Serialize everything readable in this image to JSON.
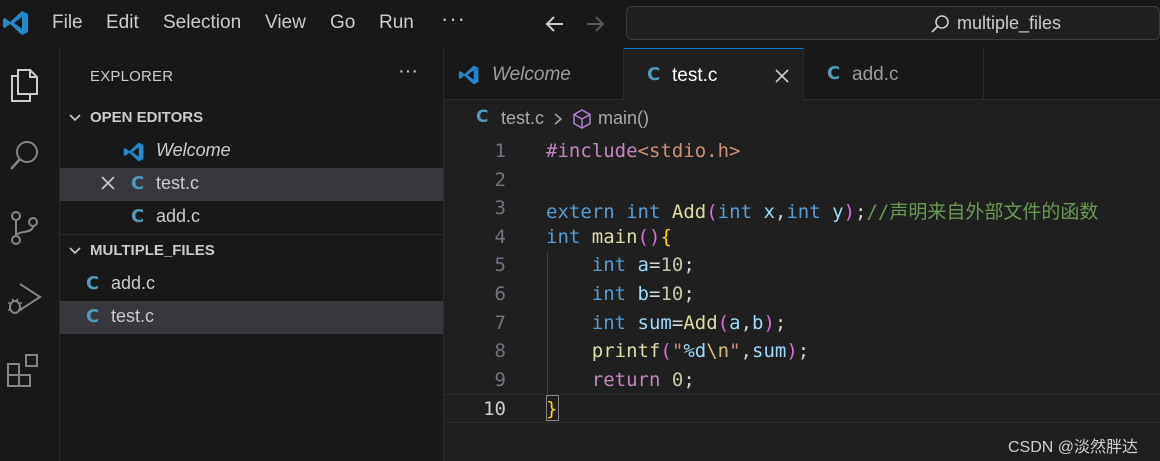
{
  "titlebar": {
    "menus": [
      "File",
      "Edit",
      "Selection",
      "View",
      "Go",
      "Run"
    ],
    "more": "···",
    "command_center": "multiple_files"
  },
  "activity_bar": {
    "icons": [
      "explorer-icon",
      "search-icon",
      "source-control-icon",
      "run-debug-icon",
      "extensions-icon"
    ]
  },
  "sidebar": {
    "title": "EXPLORER",
    "more": "···",
    "open_editors": {
      "label": "OPEN EDITORS",
      "items": [
        {
          "name": "Welcome",
          "icon": "vscode-logo-icon"
        },
        {
          "name": "test.c",
          "icon_letter": "C",
          "selected": true
        },
        {
          "name": "add.c",
          "icon_letter": "C"
        }
      ]
    },
    "folder": {
      "label": "MULTIPLE_FILES",
      "items": [
        {
          "name": "add.c",
          "icon_letter": "C"
        },
        {
          "name": "test.c",
          "icon_letter": "C",
          "selected": true
        }
      ]
    }
  },
  "tabs": [
    {
      "label": "Welcome",
      "icon": "vscode-logo-icon"
    },
    {
      "label": "test.c",
      "icon_letter": "C",
      "active": true
    },
    {
      "label": "add.c",
      "icon_letter": "C"
    }
  ],
  "breadcrumb": {
    "file": "test.c",
    "file_icon_letter": "C",
    "symbol": "main()"
  },
  "editor": {
    "line_numbers": [
      "1",
      "2",
      "3",
      "4",
      "5",
      "6",
      "7",
      "8",
      "9",
      "10"
    ],
    "current_line": "10",
    "lines": [
      [
        {
          "t": "#include",
          "c": "pp"
        },
        {
          "t": "<stdio.h>",
          "c": "str"
        }
      ],
      [],
      [
        {
          "t": "extern",
          "c": "kw"
        },
        {
          "t": " "
        },
        {
          "t": "int",
          "c": "kw"
        },
        {
          "t": " "
        },
        {
          "t": "Add",
          "c": "fn"
        },
        {
          "t": "(",
          "c": "b2"
        },
        {
          "t": "int",
          "c": "kw"
        },
        {
          "t": " "
        },
        {
          "t": "x",
          "c": "var"
        },
        {
          "t": ","
        },
        {
          "t": "int",
          "c": "kw"
        },
        {
          "t": " "
        },
        {
          "t": "y",
          "c": "var"
        },
        {
          "t": ")",
          "c": "b2"
        },
        {
          "t": ";"
        },
        {
          "t": "//声明来自外部文件的函数",
          "c": "cmt"
        }
      ],
      [
        {
          "t": "int",
          "c": "kw"
        },
        {
          "t": " "
        },
        {
          "t": "main",
          "c": "fn"
        },
        {
          "t": "()",
          "c": "b2"
        },
        {
          "t": "{",
          "c": "b1"
        }
      ],
      [
        {
          "t": "    "
        },
        {
          "t": "int",
          "c": "kw"
        },
        {
          "t": " "
        },
        {
          "t": "a",
          "c": "var"
        },
        {
          "t": "="
        },
        {
          "t": "10",
          "c": "num"
        },
        {
          "t": ";"
        }
      ],
      [
        {
          "t": "    "
        },
        {
          "t": "int",
          "c": "kw"
        },
        {
          "t": " "
        },
        {
          "t": "b",
          "c": "var"
        },
        {
          "t": "="
        },
        {
          "t": "10",
          "c": "num"
        },
        {
          "t": ";"
        }
      ],
      [
        {
          "t": "    "
        },
        {
          "t": "int",
          "c": "kw"
        },
        {
          "t": " "
        },
        {
          "t": "sum",
          "c": "var"
        },
        {
          "t": "="
        },
        {
          "t": "Add",
          "c": "fn"
        },
        {
          "t": "(",
          "c": "b2"
        },
        {
          "t": "a",
          "c": "var"
        },
        {
          "t": ","
        },
        {
          "t": "b",
          "c": "var"
        },
        {
          "t": ")",
          "c": "b2"
        },
        {
          "t": ";"
        }
      ],
      [
        {
          "t": "    "
        },
        {
          "t": "printf",
          "c": "fn"
        },
        {
          "t": "(",
          "c": "b2"
        },
        {
          "t": "\"",
          "c": "str"
        },
        {
          "t": "%d",
          "c": "var"
        },
        {
          "t": "\\n",
          "c": "esc"
        },
        {
          "t": "\"",
          "c": "str"
        },
        {
          "t": ","
        },
        {
          "t": "sum",
          "c": "var"
        },
        {
          "t": ")",
          "c": "b2"
        },
        {
          "t": ";"
        }
      ],
      [
        {
          "t": "    "
        },
        {
          "t": "return",
          "c": "ctl"
        },
        {
          "t": " "
        },
        {
          "t": "0",
          "c": "num"
        },
        {
          "t": ";"
        }
      ],
      [
        {
          "t": "}",
          "c": "b1"
        }
      ]
    ]
  },
  "watermark": "CSDN @淡然胖达",
  "colors": {
    "accent": "#0078d4",
    "c_file_icon": "#519aba",
    "vscode_logo": "#2489ca"
  }
}
